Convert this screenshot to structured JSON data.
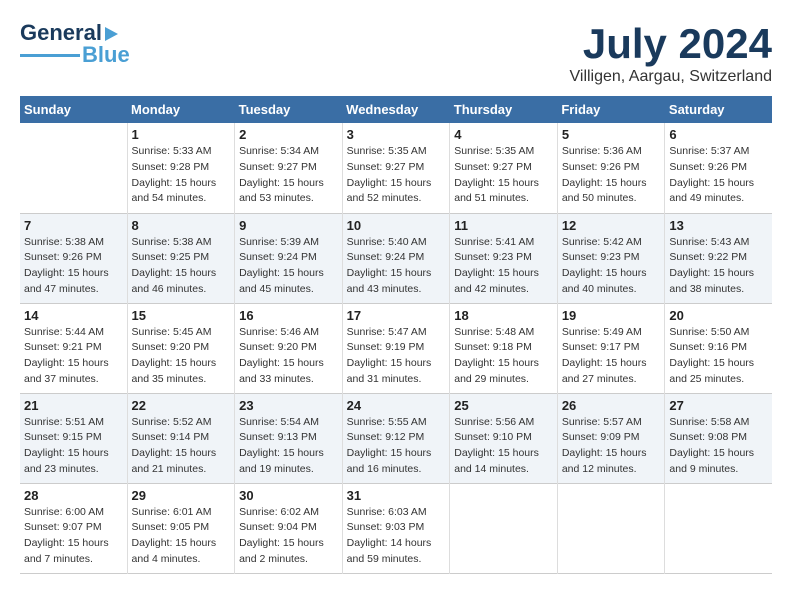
{
  "header": {
    "logo_general": "General",
    "logo_blue": "Blue",
    "month_year": "July 2024",
    "location": "Villigen, Aargau, Switzerland"
  },
  "weekdays": [
    "Sunday",
    "Monday",
    "Tuesday",
    "Wednesday",
    "Thursday",
    "Friday",
    "Saturday"
  ],
  "weeks": [
    [
      {
        "day": "",
        "info": ""
      },
      {
        "day": "1",
        "info": "Sunrise: 5:33 AM\nSunset: 9:28 PM\nDaylight: 15 hours\nand 54 minutes."
      },
      {
        "day": "2",
        "info": "Sunrise: 5:34 AM\nSunset: 9:27 PM\nDaylight: 15 hours\nand 53 minutes."
      },
      {
        "day": "3",
        "info": "Sunrise: 5:35 AM\nSunset: 9:27 PM\nDaylight: 15 hours\nand 52 minutes."
      },
      {
        "day": "4",
        "info": "Sunrise: 5:35 AM\nSunset: 9:27 PM\nDaylight: 15 hours\nand 51 minutes."
      },
      {
        "day": "5",
        "info": "Sunrise: 5:36 AM\nSunset: 9:26 PM\nDaylight: 15 hours\nand 50 minutes."
      },
      {
        "day": "6",
        "info": "Sunrise: 5:37 AM\nSunset: 9:26 PM\nDaylight: 15 hours\nand 49 minutes."
      }
    ],
    [
      {
        "day": "7",
        "info": "Sunrise: 5:38 AM\nSunset: 9:26 PM\nDaylight: 15 hours\nand 47 minutes."
      },
      {
        "day": "8",
        "info": "Sunrise: 5:38 AM\nSunset: 9:25 PM\nDaylight: 15 hours\nand 46 minutes."
      },
      {
        "day": "9",
        "info": "Sunrise: 5:39 AM\nSunset: 9:24 PM\nDaylight: 15 hours\nand 45 minutes."
      },
      {
        "day": "10",
        "info": "Sunrise: 5:40 AM\nSunset: 9:24 PM\nDaylight: 15 hours\nand 43 minutes."
      },
      {
        "day": "11",
        "info": "Sunrise: 5:41 AM\nSunset: 9:23 PM\nDaylight: 15 hours\nand 42 minutes."
      },
      {
        "day": "12",
        "info": "Sunrise: 5:42 AM\nSunset: 9:23 PM\nDaylight: 15 hours\nand 40 minutes."
      },
      {
        "day": "13",
        "info": "Sunrise: 5:43 AM\nSunset: 9:22 PM\nDaylight: 15 hours\nand 38 minutes."
      }
    ],
    [
      {
        "day": "14",
        "info": "Sunrise: 5:44 AM\nSunset: 9:21 PM\nDaylight: 15 hours\nand 37 minutes."
      },
      {
        "day": "15",
        "info": "Sunrise: 5:45 AM\nSunset: 9:20 PM\nDaylight: 15 hours\nand 35 minutes."
      },
      {
        "day": "16",
        "info": "Sunrise: 5:46 AM\nSunset: 9:20 PM\nDaylight: 15 hours\nand 33 minutes."
      },
      {
        "day": "17",
        "info": "Sunrise: 5:47 AM\nSunset: 9:19 PM\nDaylight: 15 hours\nand 31 minutes."
      },
      {
        "day": "18",
        "info": "Sunrise: 5:48 AM\nSunset: 9:18 PM\nDaylight: 15 hours\nand 29 minutes."
      },
      {
        "day": "19",
        "info": "Sunrise: 5:49 AM\nSunset: 9:17 PM\nDaylight: 15 hours\nand 27 minutes."
      },
      {
        "day": "20",
        "info": "Sunrise: 5:50 AM\nSunset: 9:16 PM\nDaylight: 15 hours\nand 25 minutes."
      }
    ],
    [
      {
        "day": "21",
        "info": "Sunrise: 5:51 AM\nSunset: 9:15 PM\nDaylight: 15 hours\nand 23 minutes."
      },
      {
        "day": "22",
        "info": "Sunrise: 5:52 AM\nSunset: 9:14 PM\nDaylight: 15 hours\nand 21 minutes."
      },
      {
        "day": "23",
        "info": "Sunrise: 5:54 AM\nSunset: 9:13 PM\nDaylight: 15 hours\nand 19 minutes."
      },
      {
        "day": "24",
        "info": "Sunrise: 5:55 AM\nSunset: 9:12 PM\nDaylight: 15 hours\nand 16 minutes."
      },
      {
        "day": "25",
        "info": "Sunrise: 5:56 AM\nSunset: 9:10 PM\nDaylight: 15 hours\nand 14 minutes."
      },
      {
        "day": "26",
        "info": "Sunrise: 5:57 AM\nSunset: 9:09 PM\nDaylight: 15 hours\nand 12 minutes."
      },
      {
        "day": "27",
        "info": "Sunrise: 5:58 AM\nSunset: 9:08 PM\nDaylight: 15 hours\nand 9 minutes."
      }
    ],
    [
      {
        "day": "28",
        "info": "Sunrise: 6:00 AM\nSunset: 9:07 PM\nDaylight: 15 hours\nand 7 minutes."
      },
      {
        "day": "29",
        "info": "Sunrise: 6:01 AM\nSunset: 9:05 PM\nDaylight: 15 hours\nand 4 minutes."
      },
      {
        "day": "30",
        "info": "Sunrise: 6:02 AM\nSunset: 9:04 PM\nDaylight: 15 hours\nand 2 minutes."
      },
      {
        "day": "31",
        "info": "Sunrise: 6:03 AM\nSunset: 9:03 PM\nDaylight: 14 hours\nand 59 minutes."
      },
      {
        "day": "",
        "info": ""
      },
      {
        "day": "",
        "info": ""
      },
      {
        "day": "",
        "info": ""
      }
    ]
  ]
}
